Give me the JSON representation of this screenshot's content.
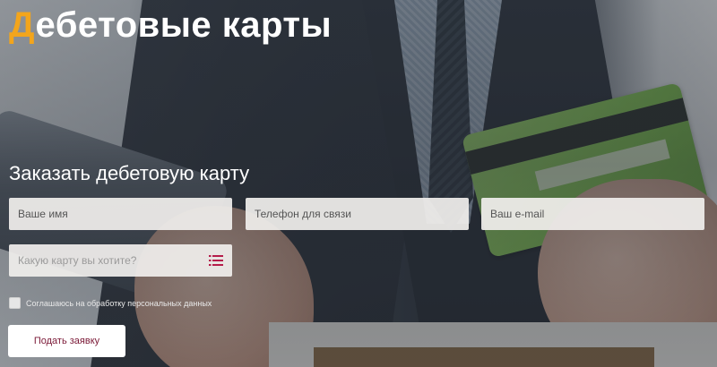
{
  "hero": {
    "title_first_letter": "Д",
    "title_rest": "ебетовые карты",
    "accent_color": "#f3a51c"
  },
  "form": {
    "heading": "Заказать дебетовую карту",
    "name_placeholder": "Ваше имя",
    "phone_placeholder": "Телефон для связи",
    "email_placeholder": "Ваш e-mail",
    "card_select_placeholder": "Какую карту вы хотите?",
    "card_select_icon": "list-icon",
    "consent_label": "Соглашаюсь на обработку персональных данных",
    "consent_checked": false,
    "submit_label": "Подать заявку",
    "submit_text_color": "#7a1836"
  }
}
